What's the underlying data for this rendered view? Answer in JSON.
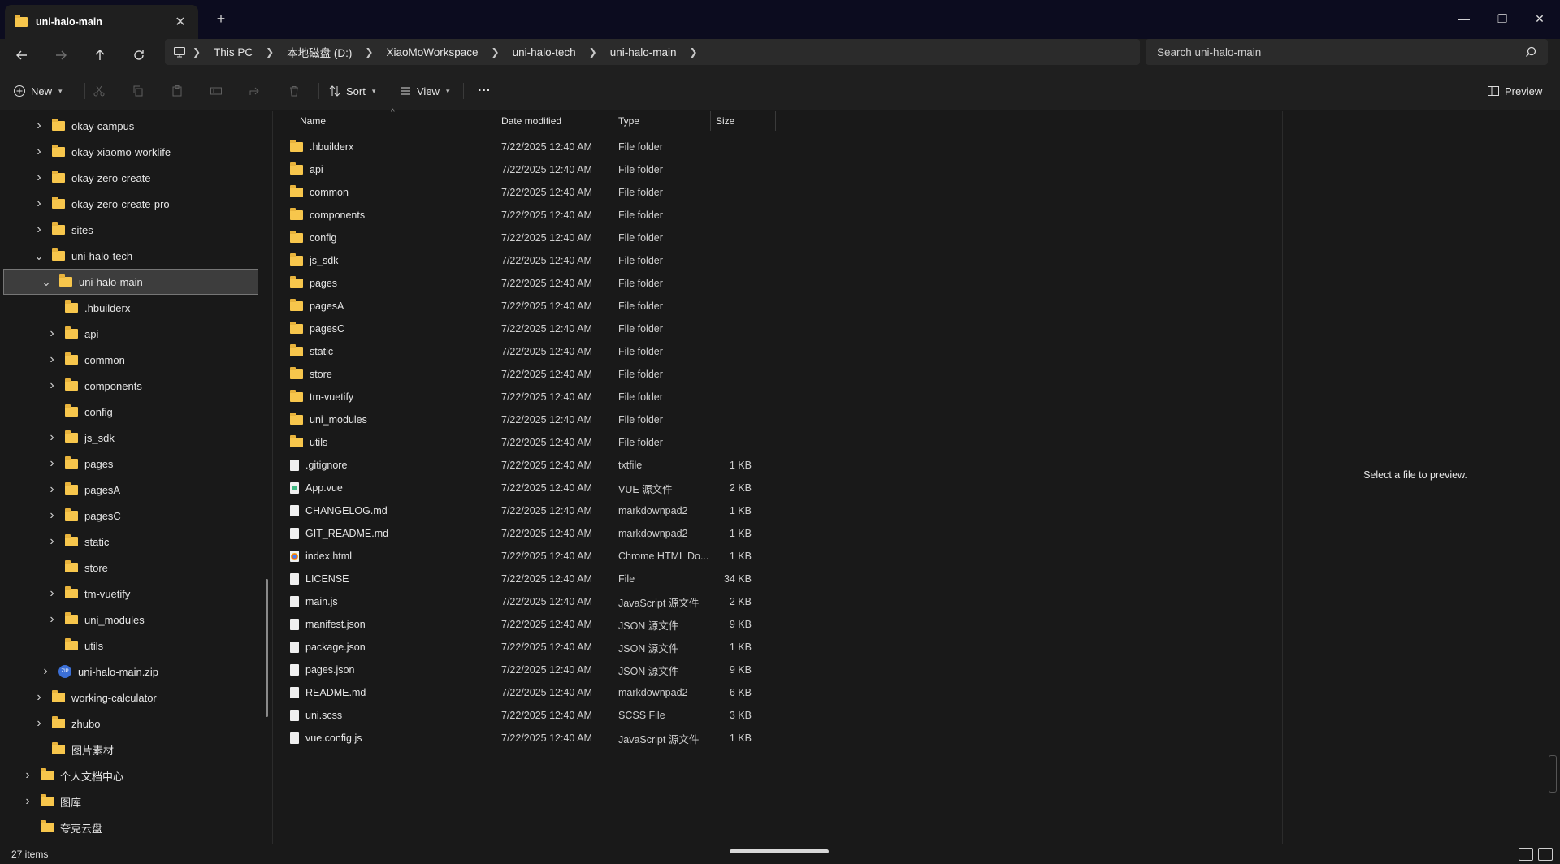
{
  "tab": {
    "title": "uni-halo-main",
    "close": "✕",
    "new": "+"
  },
  "window": {
    "minimize": "—",
    "maximize": "❐",
    "close": "✕"
  },
  "breadcrumb": [
    "This PC",
    "本地磁盘 (D:)",
    "XiaoMoWorkspace",
    "uni-halo-tech",
    "uni-halo-main"
  ],
  "search": {
    "placeholder": "Search uni-halo-main"
  },
  "toolbar": {
    "new_label": "New",
    "sort_label": "Sort",
    "view_label": "View",
    "more_label": "···",
    "preview_label": "Preview"
  },
  "nav_tree": [
    {
      "label": "okay-campus",
      "expand": "collapsed",
      "level": 1,
      "kind": "folder"
    },
    {
      "label": "okay-xiaomo-worklife",
      "expand": "collapsed",
      "level": 1,
      "kind": "folder"
    },
    {
      "label": "okay-zero-create",
      "expand": "collapsed",
      "level": 1,
      "kind": "folder"
    },
    {
      "label": "okay-zero-create-pro",
      "expand": "collapsed",
      "level": 1,
      "kind": "folder"
    },
    {
      "label": "sites",
      "expand": "collapsed",
      "level": 1,
      "kind": "folder"
    },
    {
      "label": "uni-halo-tech",
      "expand": "expanded",
      "level": 1,
      "kind": "folder"
    },
    {
      "label": "uni-halo-main",
      "expand": "expanded",
      "level": 2,
      "kind": "folder",
      "selected": true
    },
    {
      "label": ".hbuilderx",
      "expand": "none",
      "level": 3,
      "kind": "folder"
    },
    {
      "label": "api",
      "expand": "collapsed",
      "level": 3,
      "kind": "folder"
    },
    {
      "label": "common",
      "expand": "collapsed",
      "level": 3,
      "kind": "folder"
    },
    {
      "label": "components",
      "expand": "collapsed",
      "level": 3,
      "kind": "folder"
    },
    {
      "label": "config",
      "expand": "none",
      "level": 3,
      "kind": "folder"
    },
    {
      "label": "js_sdk",
      "expand": "collapsed",
      "level": 3,
      "kind": "folder"
    },
    {
      "label": "pages",
      "expand": "collapsed",
      "level": 3,
      "kind": "folder"
    },
    {
      "label": "pagesA",
      "expand": "collapsed",
      "level": 3,
      "kind": "folder"
    },
    {
      "label": "pagesC",
      "expand": "collapsed",
      "level": 3,
      "kind": "folder"
    },
    {
      "label": "static",
      "expand": "collapsed",
      "level": 3,
      "kind": "folder"
    },
    {
      "label": "store",
      "expand": "none",
      "level": 3,
      "kind": "folder"
    },
    {
      "label": "tm-vuetify",
      "expand": "collapsed",
      "level": 3,
      "kind": "folder"
    },
    {
      "label": "uni_modules",
      "expand": "collapsed",
      "level": 3,
      "kind": "folder"
    },
    {
      "label": "utils",
      "expand": "none",
      "level": 3,
      "kind": "folder"
    },
    {
      "label": "uni-halo-main.zip",
      "expand": "collapsed",
      "level": 2,
      "kind": "zip"
    },
    {
      "label": "working-calculator",
      "expand": "collapsed",
      "level": 1,
      "kind": "folder"
    },
    {
      "label": "zhubo",
      "expand": "collapsed",
      "level": 1,
      "kind": "folder"
    },
    {
      "label": "图片素材",
      "expand": "none",
      "level": 1,
      "kind": "folder"
    },
    {
      "label": "个人文档中心",
      "expand": "collapsed",
      "level": 0,
      "kind": "folder"
    },
    {
      "label": "图库",
      "expand": "collapsed",
      "level": 0,
      "kind": "folder"
    },
    {
      "label": "夸克云盘",
      "expand": "none",
      "level": 0,
      "kind": "folder"
    }
  ],
  "columns": {
    "name": "Name",
    "date": "Date modified",
    "type": "Type",
    "size": "Size"
  },
  "files": [
    {
      "name": ".hbuilderx",
      "date": "7/22/2025 12:40 AM",
      "type": "File folder",
      "size": "",
      "kind": "folder"
    },
    {
      "name": "api",
      "date": "7/22/2025 12:40 AM",
      "type": "File folder",
      "size": "",
      "kind": "folder"
    },
    {
      "name": "common",
      "date": "7/22/2025 12:40 AM",
      "type": "File folder",
      "size": "",
      "kind": "folder"
    },
    {
      "name": "components",
      "date": "7/22/2025 12:40 AM",
      "type": "File folder",
      "size": "",
      "kind": "folder"
    },
    {
      "name": "config",
      "date": "7/22/2025 12:40 AM",
      "type": "File folder",
      "size": "",
      "kind": "folder"
    },
    {
      "name": "js_sdk",
      "date": "7/22/2025 12:40 AM",
      "type": "File folder",
      "size": "",
      "kind": "folder"
    },
    {
      "name": "pages",
      "date": "7/22/2025 12:40 AM",
      "type": "File folder",
      "size": "",
      "kind": "folder"
    },
    {
      "name": "pagesA",
      "date": "7/22/2025 12:40 AM",
      "type": "File folder",
      "size": "",
      "kind": "folder"
    },
    {
      "name": "pagesC",
      "date": "7/22/2025 12:40 AM",
      "type": "File folder",
      "size": "",
      "kind": "folder"
    },
    {
      "name": "static",
      "date": "7/22/2025 12:40 AM",
      "type": "File folder",
      "size": "",
      "kind": "folder"
    },
    {
      "name": "store",
      "date": "7/22/2025 12:40 AM",
      "type": "File folder",
      "size": "",
      "kind": "folder"
    },
    {
      "name": "tm-vuetify",
      "date": "7/22/2025 12:40 AM",
      "type": "File folder",
      "size": "",
      "kind": "folder"
    },
    {
      "name": "uni_modules",
      "date": "7/22/2025 12:40 AM",
      "type": "File folder",
      "size": "",
      "kind": "folder"
    },
    {
      "name": "utils",
      "date": "7/22/2025 12:40 AM",
      "type": "File folder",
      "size": "",
      "kind": "folder"
    },
    {
      "name": ".gitignore",
      "date": "7/22/2025 12:40 AM",
      "type": "txtfile",
      "size": "1 KB",
      "kind": "file"
    },
    {
      "name": "App.vue",
      "date": "7/22/2025 12:40 AM",
      "type": "VUE 源文件",
      "size": "2 KB",
      "kind": "vue"
    },
    {
      "name": "CHANGELOG.md",
      "date": "7/22/2025 12:40 AM",
      "type": "markdownpad2",
      "size": "1 KB",
      "kind": "file"
    },
    {
      "name": "GIT_README.md",
      "date": "7/22/2025 12:40 AM",
      "type": "markdownpad2",
      "size": "1 KB",
      "kind": "file"
    },
    {
      "name": "index.html",
      "date": "7/22/2025 12:40 AM",
      "type": "Chrome HTML Do...",
      "size": "1 KB",
      "kind": "chrome"
    },
    {
      "name": "LICENSE",
      "date": "7/22/2025 12:40 AM",
      "type": "File",
      "size": "34 KB",
      "kind": "file"
    },
    {
      "name": "main.js",
      "date": "7/22/2025 12:40 AM",
      "type": "JavaScript 源文件",
      "size": "2 KB",
      "kind": "file"
    },
    {
      "name": "manifest.json",
      "date": "7/22/2025 12:40 AM",
      "type": "JSON 源文件",
      "size": "9 KB",
      "kind": "file"
    },
    {
      "name": "package.json",
      "date": "7/22/2025 12:40 AM",
      "type": "JSON 源文件",
      "size": "1 KB",
      "kind": "file"
    },
    {
      "name": "pages.json",
      "date": "7/22/2025 12:40 AM",
      "type": "JSON 源文件",
      "size": "9 KB",
      "kind": "file"
    },
    {
      "name": "README.md",
      "date": "7/22/2025 12:40 AM",
      "type": "markdownpad2",
      "size": "6 KB",
      "kind": "file"
    },
    {
      "name": "uni.scss",
      "date": "7/22/2025 12:40 AM",
      "type": "SCSS File",
      "size": "3 KB",
      "kind": "file"
    },
    {
      "name": "vue.config.js",
      "date": "7/22/2025 12:40 AM",
      "type": "JavaScript 源文件",
      "size": "1 KB",
      "kind": "file"
    }
  ],
  "preview": {
    "message": "Select a file to preview."
  },
  "status": {
    "item_count": "27 items"
  }
}
